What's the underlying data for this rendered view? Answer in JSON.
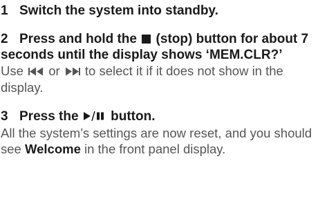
{
  "steps": [
    {
      "number": "1",
      "heading": "Switch the system into standby."
    },
    {
      "number": "2",
      "heading_part1": "Press and hold the",
      "stop_icon": "stop-square-icon",
      "heading_part2": "(stop) button for about 7 seconds until the display shows ‘MEM.CLR?’",
      "body_part1": "Use",
      "prev_icon": "skip-back-icon",
      "body_or": "or",
      "next_icon": "skip-forward-icon",
      "body_part2": "to select it if it does not show in the display."
    },
    {
      "number": "3",
      "heading_part1": "Press the",
      "play_pause_icon": "play-pause-icon",
      "heading_part2": "button.",
      "body_part1": "All the system’s settings are now reset, and you should see",
      "body_bold": "Welcome",
      "body_part2": "in the front panel display."
    }
  ]
}
